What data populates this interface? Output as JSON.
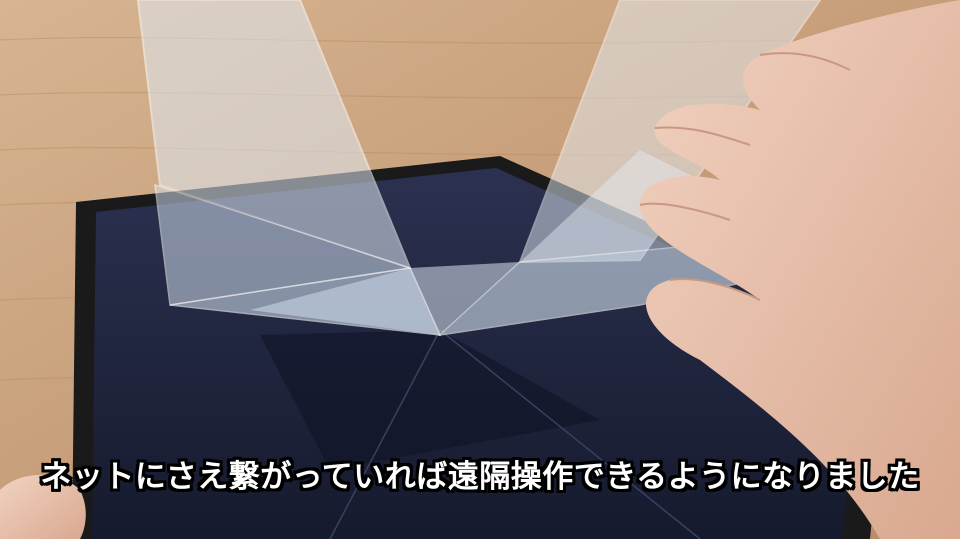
{
  "caption": {
    "text": "ネットにさえ繋がっていれば遠隔操作できるようになりました"
  },
  "colors": {
    "table": "#c9a27f",
    "tablet_frame": "#1c1c1c",
    "tablet_screen": "#1d2440",
    "acrylic": "#d8e6f2",
    "skin": "#e9c2ad",
    "caption_text": "#ffffff",
    "caption_outline": "#000000"
  }
}
